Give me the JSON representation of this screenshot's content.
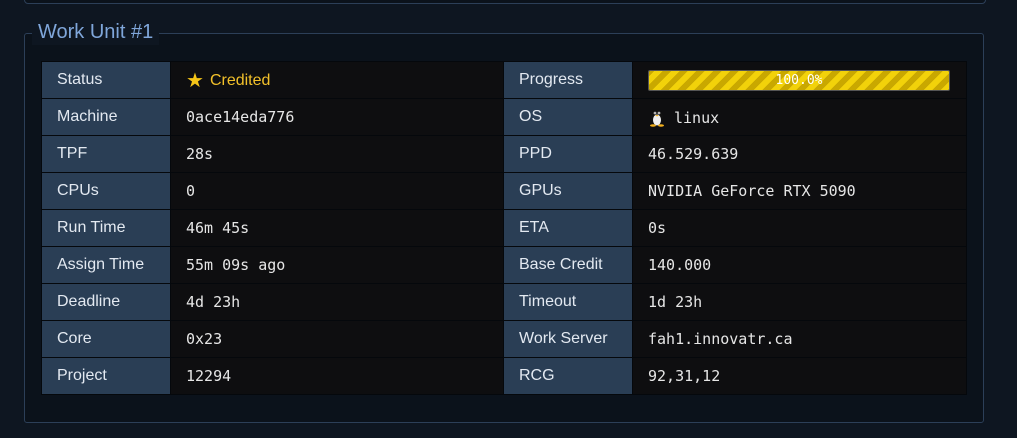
{
  "work_unit": {
    "title": "Work Unit #1",
    "rows": [
      {
        "left_label": "Status",
        "left_value": "Credited",
        "right_label": "Progress",
        "right_value": "100.0%"
      },
      {
        "left_label": "Machine",
        "left_value": "0ace14eda776",
        "right_label": "OS",
        "right_value": "linux"
      },
      {
        "left_label": "TPF",
        "left_value": "28s",
        "right_label": "PPD",
        "right_value": "46.529.639"
      },
      {
        "left_label": "CPUs",
        "left_value": "0",
        "right_label": "GPUs",
        "right_value": "NVIDIA GeForce RTX 5090"
      },
      {
        "left_label": "Run Time",
        "left_value": "46m 45s",
        "right_label": "ETA",
        "right_value": "0s"
      },
      {
        "left_label": "Assign Time",
        "left_value": "55m 09s ago",
        "right_label": "Base Credit",
        "right_value": "140.000"
      },
      {
        "left_label": "Deadline",
        "left_value": "4d 23h",
        "right_label": "Timeout",
        "right_value": "1d 23h"
      },
      {
        "left_label": "Core",
        "left_value": "0x23",
        "right_label": "Work Server",
        "right_value": "fah1.innovatr.ca"
      },
      {
        "left_label": "Project",
        "left_value": "12294",
        "right_label": "RCG",
        "right_value": "92,31,12"
      }
    ],
    "progress_fraction": 1.0,
    "status_icon": "star-icon",
    "os_icon": "linux-tux-icon",
    "colors": {
      "accent": "#7fa6da",
      "status": "#f3c12a",
      "progress": "#f2d20a",
      "label_bg": "#2a3e55"
    }
  }
}
